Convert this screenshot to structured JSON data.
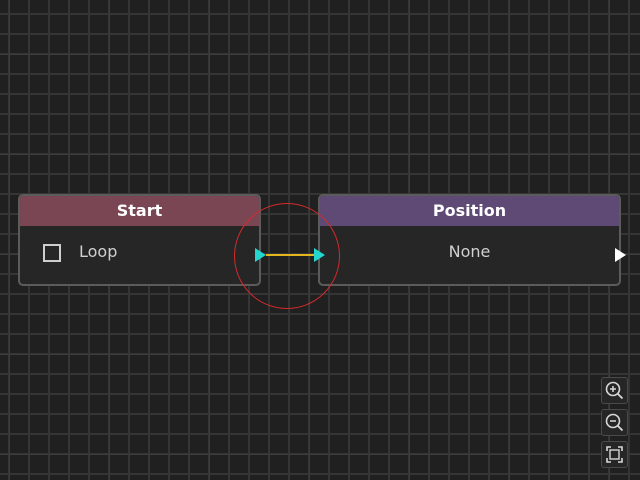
{
  "nodes": {
    "start": {
      "title": "Start",
      "header_color": "#7a4654",
      "checkbox_label": "Loop",
      "checked": false
    },
    "position": {
      "title": "Position",
      "header_color": "#5f4a76",
      "value": "None"
    }
  },
  "connection": {
    "wire_color": "#e5b51c",
    "port_color": "#23d6cf"
  },
  "toolbar": {
    "zoom_in_icon": "zoom-in-icon",
    "zoom_out_icon": "zoom-out-icon",
    "fit_view_icon": "fit-view-icon"
  },
  "colors": {
    "background": "#202020",
    "highlight": "#d42a2a"
  }
}
